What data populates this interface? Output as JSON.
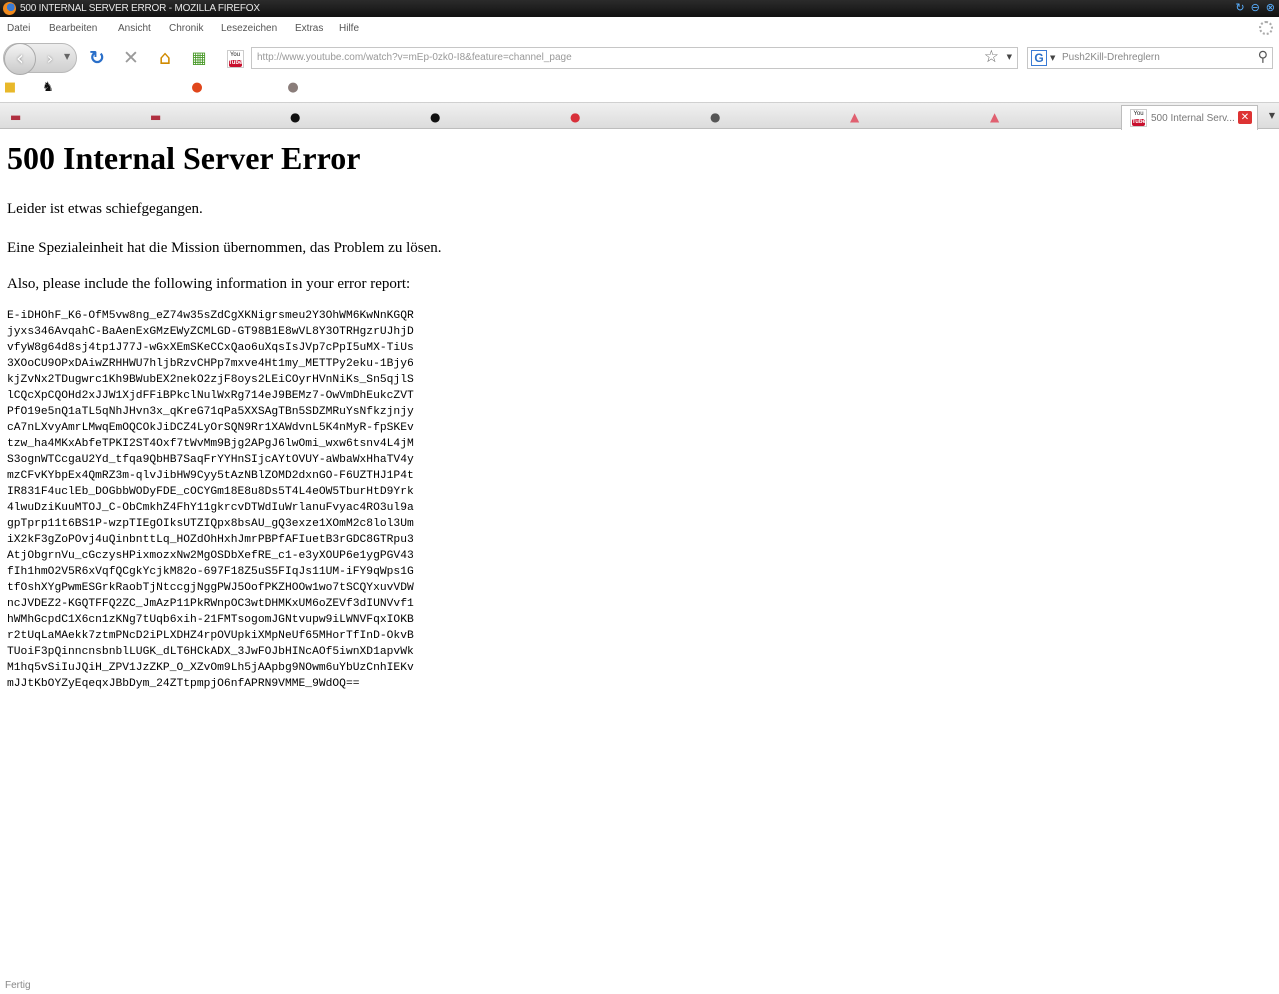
{
  "window": {
    "title": "500 INTERNAL SERVER ERROR - MOZILLA FIREFOX"
  },
  "menu": {
    "items": [
      "Datei",
      "Bearbeiten",
      "Ansicht",
      "Chronik",
      "Lesezeichen",
      "Extras",
      "Hilfe"
    ]
  },
  "nav": {
    "url": "http://www.youtube.com/watch?v=mEp-0zk0-I8&feature=channel_page",
    "search_placeholder": "Push2Kill-Drehreglern",
    "search_engine": "G"
  },
  "tabs": {
    "active_title": "500 Internal Serv...",
    "close_glyph": "✕"
  },
  "page": {
    "heading": "500 Internal Server Error",
    "line1": "Leider ist etwas schiefgegangen.",
    "line2": "Eine Spezialeinheit hat die Mission übernommen, das Problem zu lösen.",
    "line3": "Also, please include the following information in your error report:",
    "error_code": [
      "E-iDHOhF_K6-OfM5vw8ng_eZ74w35sZdCgXKNigrsmeu2Y3OhWM6KwNnKGQR",
      "jyxs346AvqahC-BaAenExGMzEWyZCMLGD-GT98B1E8wVL8Y3OTRHgzrUJhjD",
      "vfyW8g64d8sj4tp1J77J-wGxXEmSKeCCxQao6uXqsIsJVp7cPpI5uMX-TiUs",
      "3XOoCU9OPxDAiwZRHHWU7hljbRzvCHPp7mxve4Ht1my_METTPy2eku-1Bjy6",
      "kjZvNx2TDugwrc1Kh9BWubEX2nekO2zjF8oys2LEiCOyrHVnNiKs_Sn5qjlS",
      "lCQcXpCQOHd2xJJW1XjdFFiBPkclNulWxRg714eJ9BEMz7-OwVmDhEukcZVT",
      "PfO19e5nQ1aTL5qNhJHvn3x_qKreG71qPa5XXSAgTBn5SDZMRuYsNfkzjnjy",
      "cA7nLXvyAmrLMwqEmOQCOkJiDCZ4LyOrSQN9Rr1XAWdvnL5K4nMyR-fpSKEv",
      "tzw_ha4MKxAbfeTPKI2ST4Oxf7tWvMm9Bjg2APgJ6lwOmi_wxw6tsnv4L4jM",
      "S3ognWTCcgaU2Yd_tfqa9QbHB7SaqFrYYHnSIjcAYtOVUY-aWbaWxHhaTV4y",
      "mzCFvKYbpEx4QmRZ3m-qlvJibHW9Cyy5tAzNBlZOMD2dxnGO-F6UZTHJ1P4t",
      "IR831F4uclEb_DOGbbWODyFDE_cOCYGm18E8u8Ds5T4L4eOW5TburHtD9Yrk",
      "4lwuDziKuuMTOJ_C-ObCmkhZ4FhY11gkrcvDTWdIuWrlanuFvyac4RO3ul9a",
      "gpTprp11t6BS1P-wzpTIEgOIksUTZIQpx8bsAU_gQ3exze1XOmM2c8lol3Um",
      "iX2kF3gZoPOvj4uQinbnttLq_HOZdOhHxhJmrPBPfAFIuetB3rGDC8GTRpu3",
      "AtjObgrnVu_cGczysHPixmozxNw2MgOSDbXefRE_c1-e3yXOUP6e1ygPGV43",
      "fIh1hmO2V5R6xVqfQCgkYcjkM82o-697F18Z5uS5FIqJs11UM-iFY9qWps1G",
      "tfOshXYgPwmESGrkRaobTjNtccgjNggPWJ5OofPKZHOOw1wo7tSCQYxuvVDW",
      "ncJVDEZ2-KGQTFFQ2ZC_JmAzP11PkRWnpOC3wtDHMKxUM6oZEVf3dIUNVvf1",
      "hWMhGcpdC1X6cn1zKNg7tUqb6xih-21FMTsogomJGNtvupw9iLWNVFqxIOKB",
      "r2tUqLaMAekk7ztmPNcD2iPLXDHZ4rpOVUpkiXMpNeUf65MHorTfInD-OkvB",
      "TUoiF3pQinncnsbnblLUGK_dLT6HCkADX_3JwFOJbHINcAOf5iwnXD1apvWk",
      "M1hq5vSiIuJQiH_ZPV1JzZKP_O_XZvOm9Lh5jAApbg9NOwm6uYbUzCnhIEKv",
      "mJJtKbOYZyEqeqxJBbDym_24ZTtpmpjO6nfAPRN9VMME_9WdOQ=="
    ]
  },
  "status": {
    "text": "Fertig"
  }
}
